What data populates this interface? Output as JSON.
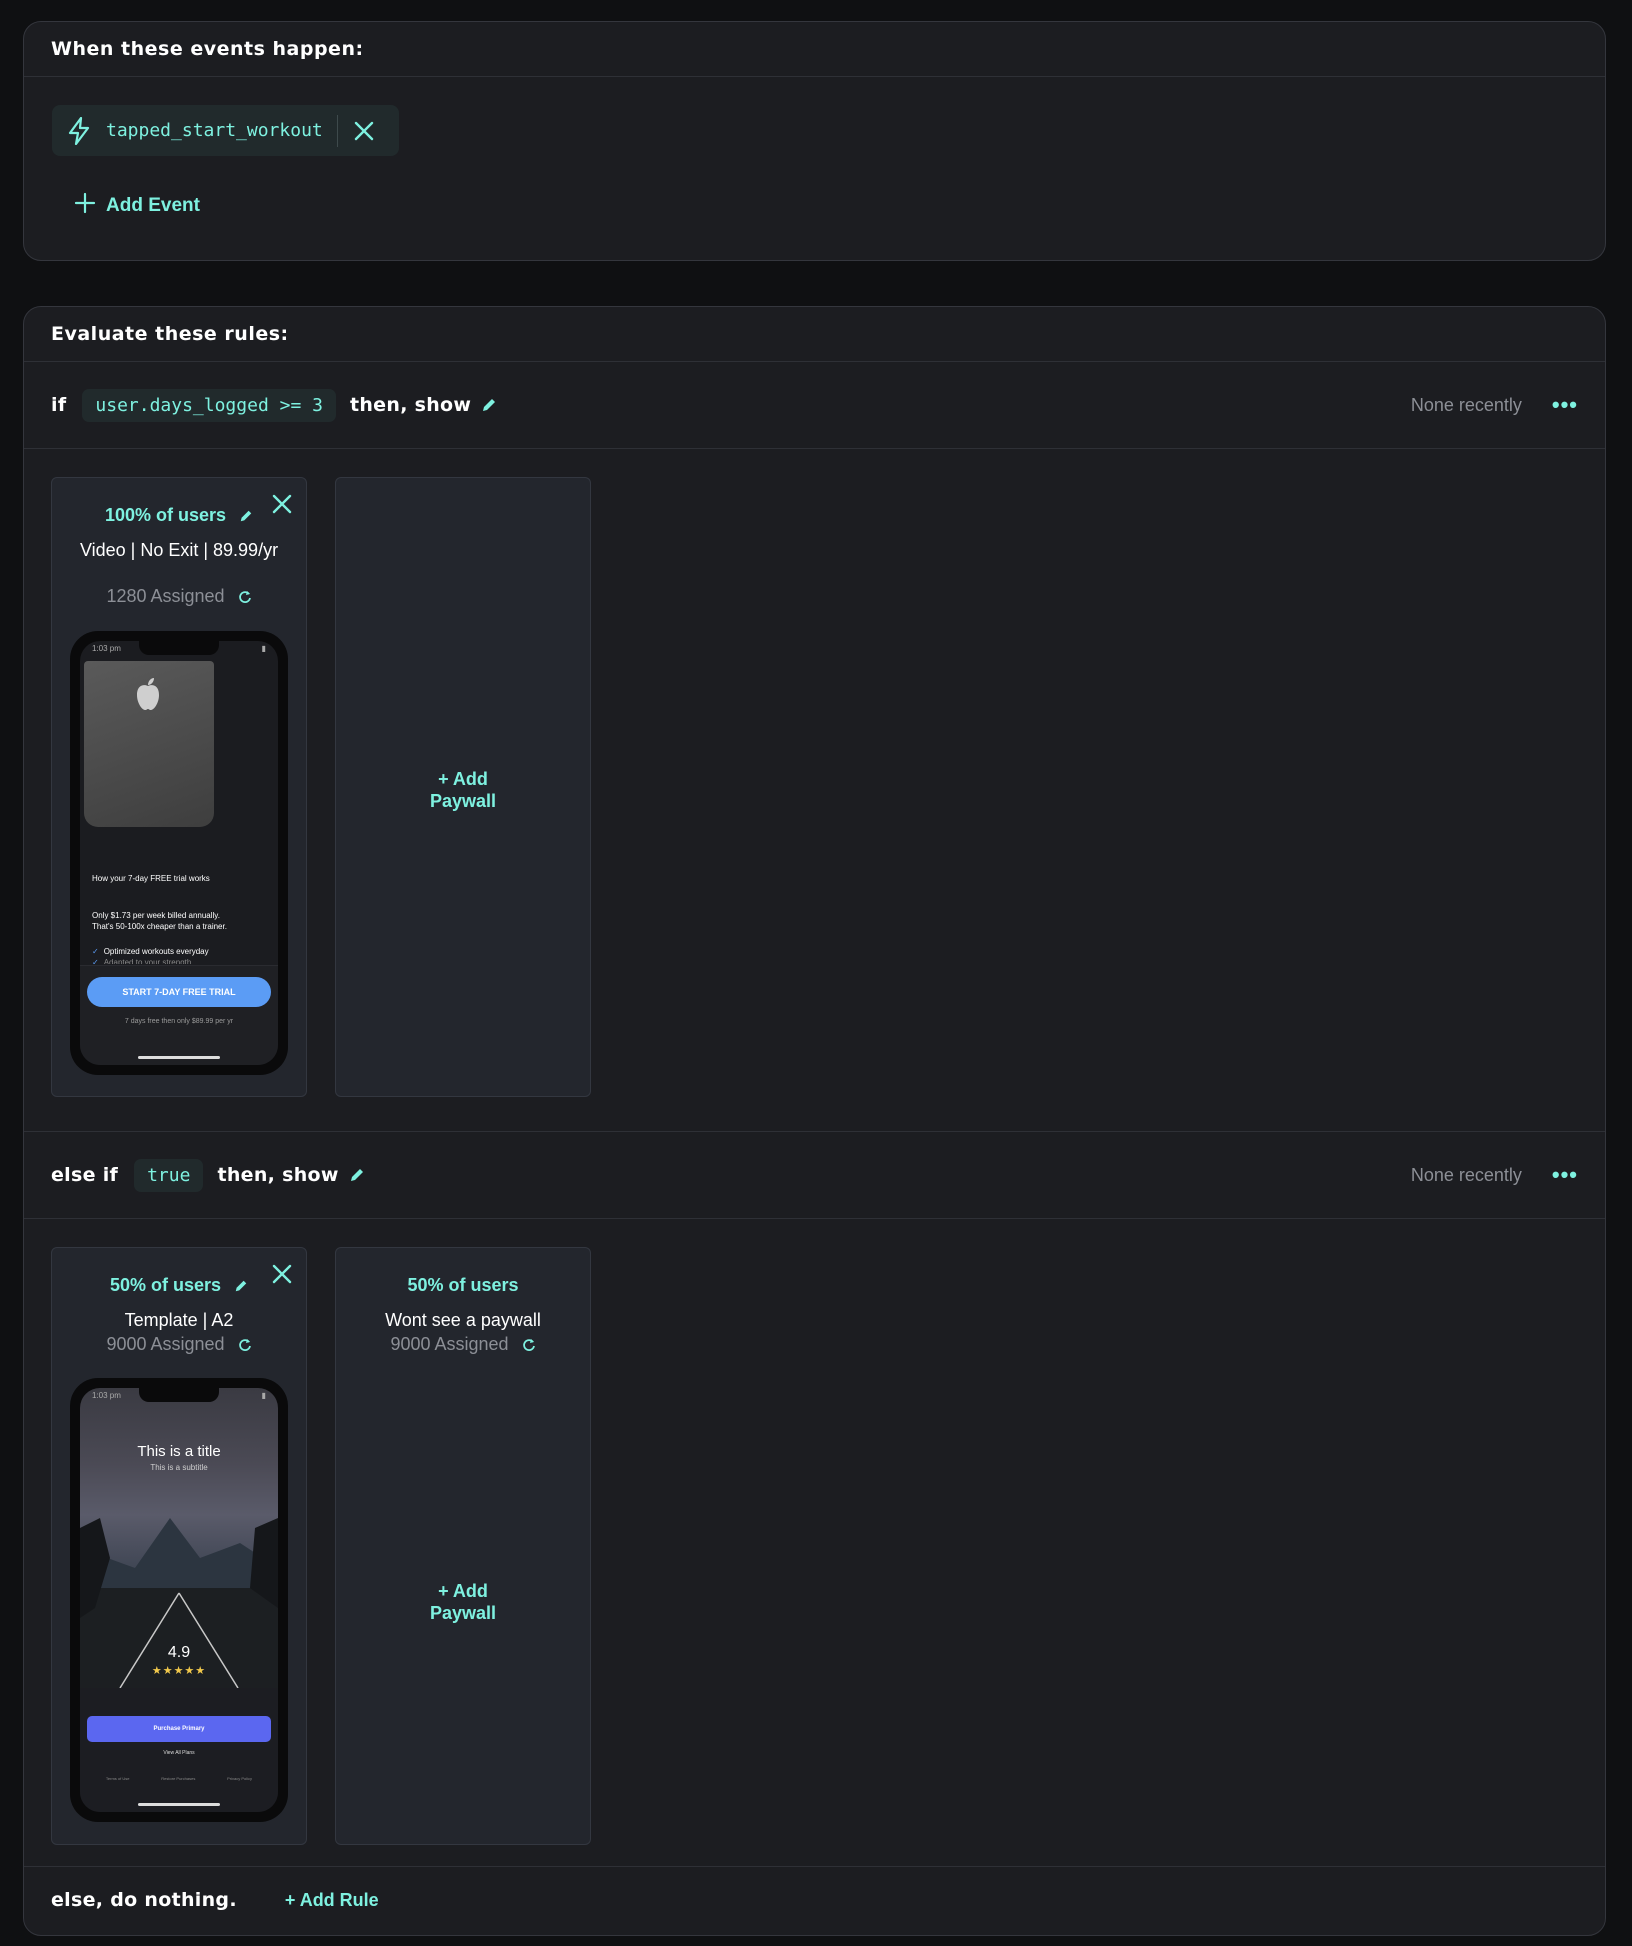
{
  "events_card": {
    "title": "When these events happen:",
    "event_name": "tapped_start_workout",
    "add_event_label": "Add Event"
  },
  "rules_card": {
    "title": "Evaluate these rules:",
    "rules": [
      {
        "prefix": "if",
        "condition": "user.days_logged >= 3",
        "suffix": "then, show",
        "recent": "None recently",
        "paywalls": [
          {
            "percent": "100% of users",
            "name": "Video | No Exit | 89.99/yr",
            "assigned": "1280 Assigned",
            "preview": {
              "time": "1:03 pm",
              "heading": "How your 7-day FREE trial works",
              "line1": "Only $1.73 per week billed annually.",
              "line2": "That's 50-100x cheaper than a trainer.",
              "check1": "Optimized workouts everyday",
              "check2": "Adapted to your strength",
              "cta": "START 7-DAY FREE TRIAL",
              "fine": "7 days free then only $89.99 per yr"
            }
          }
        ],
        "add_paywall_line1": "+ Add",
        "add_paywall_line2": "Paywall"
      },
      {
        "prefix": "else if",
        "condition": "true",
        "suffix": "then, show",
        "recent": "None recently",
        "paywalls": [
          {
            "percent": "50% of users",
            "name": "Template | A2",
            "assigned": "9000 Assigned",
            "preview": {
              "time": "1:03 pm",
              "title": "This is a title",
              "subtitle": "This is a subtitle",
              "rating": "4.9",
              "stars": "★★★★★",
              "cta": "Purchase Primary",
              "secondary": "View All Plans",
              "links": [
                "Terms of Use",
                "Restore Purchases",
                "Privacy Policy"
              ]
            }
          },
          {
            "percent": "50% of users",
            "name": "Wont see a paywall",
            "assigned": "9000 Assigned"
          }
        ],
        "add_paywall_line1": "+ Add",
        "add_paywall_line2": "Paywall"
      }
    ],
    "else_label": "else, do nothing.",
    "add_rule_label": "+ Add Rule"
  },
  "colors": {
    "accent": "#7ef1e0",
    "background": "#0f1012",
    "card": "#1c1d21",
    "muted": "#8c8f96",
    "cta_blue": "#5b9cf5",
    "cta_indigo": "#5b67f0"
  },
  "icons": [
    "bolt-icon",
    "close-icon",
    "plus-icon",
    "pencil-icon",
    "refresh-icon",
    "more-icon",
    "apple-icon",
    "check-icon"
  ]
}
